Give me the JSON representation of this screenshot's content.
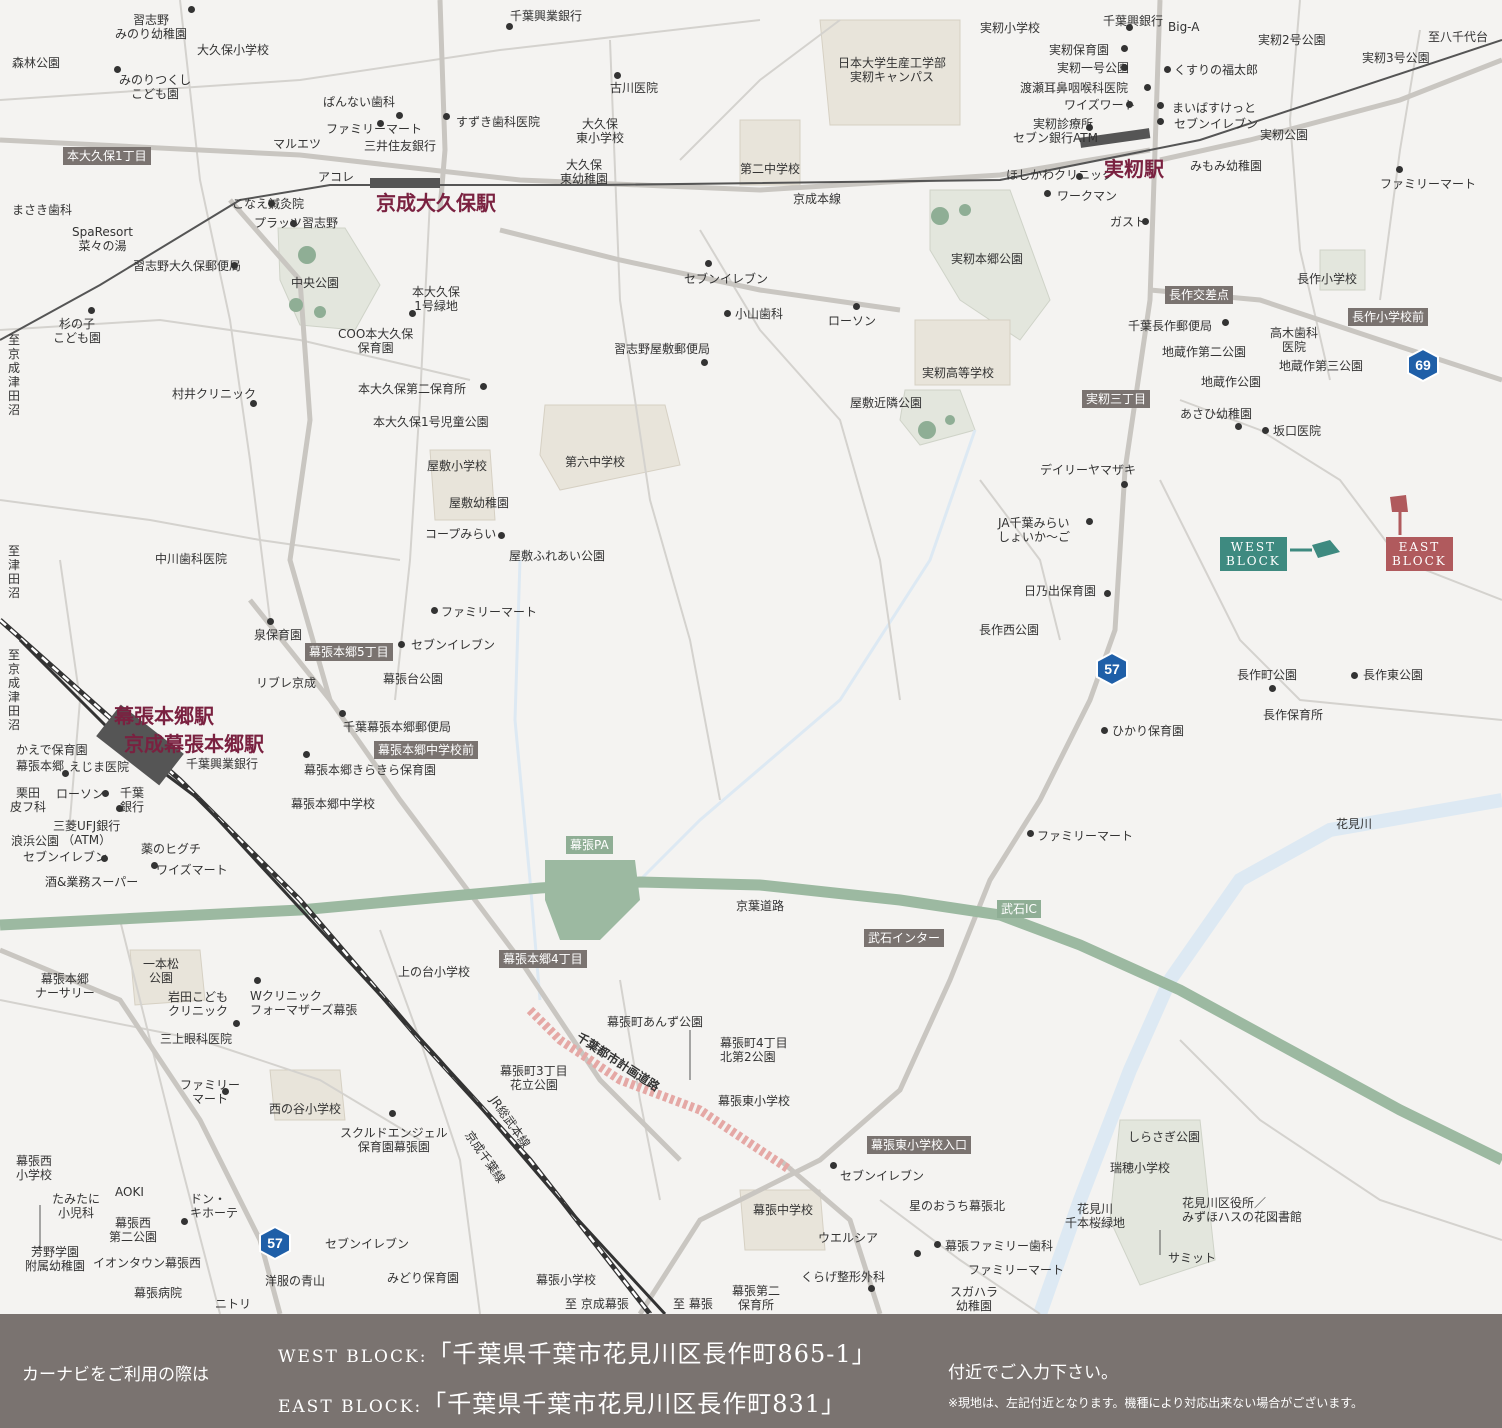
{
  "labels": {
    "l1": "習志野\nみのり幼稚園",
    "l2": "大久保小学校",
    "l3": "森林公園",
    "l4": "みのりつくし\nこども園",
    "l5": "千葉興業銀行",
    "l6": "古川医院",
    "l7": "ぱんない歯科",
    "l8": "ファミリーマート",
    "l9": "すずき歯科医院",
    "l10": "大久保\n東小学校",
    "l11": "マルエツ",
    "l12": "三井住友銀行",
    "l13": "大久保\n東幼稚園",
    "l14": "第二中学校",
    "l15": "日本大学生産工学部\n実籾キャンパス",
    "l16": "実籾小学校",
    "l17": "千葉興銀行",
    "l18": "Big-A",
    "l19": "実籾2号公園",
    "l20": "至八千代台",
    "l21": "実籾保育園",
    "l22": "実籾一号公園",
    "l23": "くすりの福太郎",
    "l24": "実籾3号公園",
    "l25": "渡瀬耳鼻咽喉科医院",
    "l26": "ワイズワート",
    "l27": "まいばすけっと",
    "l28": "実籾診療所",
    "l29": "セブンイレブン",
    "l30": "セブン銀行ATM",
    "l31": "実籾公園",
    "l32": "ほしかわクリニック",
    "l33": "みもみ幼稚園",
    "l34": "ワークマン",
    "l35": "ファミリーマート",
    "l36": "アコレ",
    "l37": "こなえ鍼灸院",
    "l38": "プラッツ習志野",
    "l39": "京成本線",
    "l40": "まさき歯科",
    "l41": "SpaResort\n菜々の湯",
    "l42": "ガスト",
    "l43": "習志野大久保郵便局",
    "l44": "中央公園",
    "l45": "セブンイレブン",
    "l46": "実籾本郷公園",
    "l47": "長作小学校",
    "l48": "本大久保\n1号緑地",
    "l49": "小山歯科",
    "l50": "ローソン",
    "l51": "杉の子\nこども園",
    "l52": "COO本大久保\n保育園",
    "l53": "千葉長作郵便局",
    "l54": "高木歯科\n医院",
    "l55": "習志野屋敷郵便局",
    "l56": "地蔵作第二公園",
    "l57": "地蔵作第三公園",
    "l58": "実籾高等学校",
    "l59": "地蔵作公園",
    "l60": "本大久保第二保育所",
    "l61": "村井クリニック",
    "l62": "屋敷近隣公園",
    "l63": "あさひ幼稚園",
    "l64": "本大久保1号児童公園",
    "l65": "坂口医院",
    "l66": "屋敷小学校",
    "l67": "第六中学校",
    "l68": "デイリーヤマザキ",
    "l69": "屋敷幼稚園",
    "l70": "JA千葉みらい\nしょいか～ご",
    "l71": "コープみらい",
    "l72": "中川歯科医院",
    "l73": "屋敷ふれあい公園",
    "l74": "日乃出保育園",
    "l75": "ファミリーマート",
    "l76": "長作西公園",
    "l77": "泉保育園",
    "l78": "セブンイレブン",
    "l79": "幕張台公園",
    "l80": "リブレ京成",
    "l81": "長作町公園",
    "l82": "長作東公園",
    "l83": "長作保育所",
    "l84": "千葉幕張本郷郵便局",
    "l85": "ひかり保育園",
    "l86": "かえで保育園",
    "l87": "幕張本郷",
    "l88": "えじま医院",
    "l89": "千葉興業銀行",
    "l90": "幕張本郷きらきら保育園",
    "l91": "栗田\n皮フ科",
    "l92": "ローソン",
    "l93": "千葉\n銀行",
    "l94": "幕張本郷中学校",
    "l95": "三菱UFJ銀行\n（ATM）",
    "l96": "浪浜公園",
    "l97": "薬のヒグチ",
    "l98": "ファミリーマート",
    "l99": "花見川",
    "l100": "セブンイレブン",
    "l101": "ワイズマート",
    "l102": "酒&業務スーパー",
    "l103": "京葉道路",
    "l104": "一本松\n公園",
    "l105": "上の台小学校",
    "l106": "幕張本郷\nナーサリー",
    "l107": "岩田こども\nクリニック",
    "l108": "Wクリニック\nフォーマザーズ幕張",
    "l109": "幕張町あんず公園",
    "l110": "三上眼科医院",
    "l111": "幕張町4丁目\n北第2公園",
    "l112": "幕張町3丁目\n花立公園",
    "l113": "ファミリー\nマート",
    "l114": "幕張東小学校",
    "l115": "西の谷小学校",
    "l116": "スクルドエンジェル\n保育園幕張園",
    "l117": "しらさぎ公園",
    "l118": "幕張西\n小学校",
    "l119": "瑞穂小学校",
    "l120": "セブンイレブン",
    "l121": "AOKI",
    "l122": "たみたに\n小児科",
    "l123": "ドン・\nキホーテ",
    "l124": "星のおうち幕張北",
    "l125": "幕張中学校",
    "l126": "花見川区役所／\nみずほハスの花図書館",
    "l127": "幕張西\n第二公園",
    "l128": "花見川\n千本桜緑地",
    "l129": "ウエルシア",
    "l130": "幕張ファミリー歯科",
    "l131": "芳野学園\n附属幼稚園",
    "l132": "イオンタウン幕張西",
    "l133": "セブンイレブン",
    "l134": "サミット",
    "l135": "くらげ整形外科",
    "l136": "ファミリーマート",
    "l137": "洋服の青山",
    "l138": "みどり保育園",
    "l139": "スガハラ\n幼稚園",
    "l140": "幕張病院",
    "l141": "ニトリ",
    "l142": "幕張小学校",
    "l143": "幕張第二\n保育所",
    "l144": "至 京成幕張",
    "l145": "至 幕張",
    "l146": "千葉都市計画道路",
    "l147": "JR総武本線",
    "l148": "京成千葉線",
    "l149": "至\n京\n成\n津\n田\n沼",
    "l150": "至\n津\n田\n沼",
    "l151": "至\n京\n成\n津\n田\n沼"
  },
  "tags": {
    "t1": "本大久保1丁目",
    "t2": "長作交差点",
    "t3": "長作小学校前",
    "t4": "実籾三丁目",
    "t5": "幕張本郷5丁目",
    "t6": "幕張本郷中学校前",
    "t7": "幕張PA",
    "t8": "武石IC",
    "t9": "武石インター",
    "t10": "幕張本郷4丁目",
    "t11": "幕張東小学校入口"
  },
  "stations": {
    "s1": "京成大久保駅",
    "s2": "実籾駅",
    "s3": "幕張本郷駅",
    "s4": "京成幕張本郷駅"
  },
  "routes": {
    "r1": "69",
    "r2": "57",
    "r3": "57"
  },
  "blocks": {
    "west": "WEST\nBLOCK",
    "east": "EAST\nBLOCK",
    "west_color": "#3e8a80",
    "east_color": "#b05a5d"
  },
  "footer": {
    "intro": "カーナビをご利用の際は",
    "west_label": "WEST BLOCK:",
    "west_addr": "「千葉県千葉市花見川区長作町865-1」",
    "east_label": "EAST BLOCK:",
    "east_addr": "「千葉県千葉市花見川区長作町831」",
    "tail": "付近でご入力下さい。",
    "note": "※現地は、左記付近となります。機種により対応出来ない場合がございます。"
  }
}
